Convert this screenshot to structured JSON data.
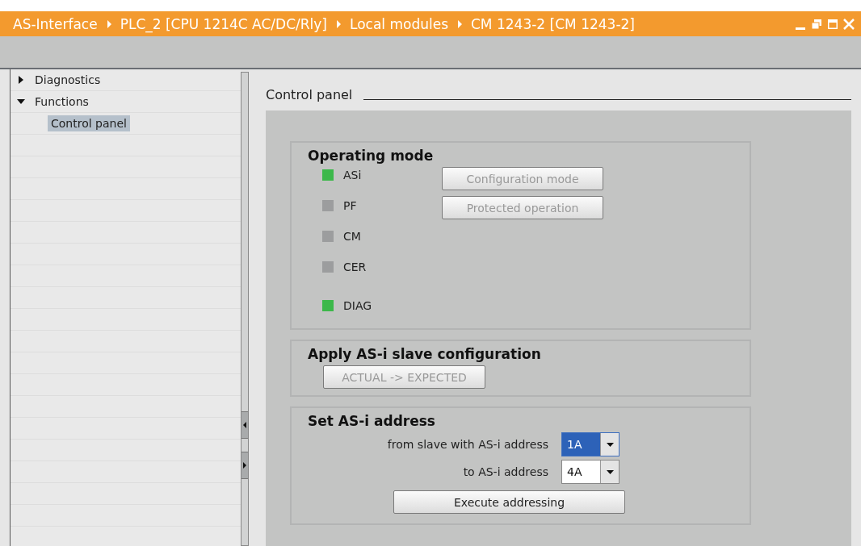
{
  "breadcrumb": [
    "AS-Interface",
    "PLC_2 [CPU 1214C AC/DC/Rly]",
    "Local modules",
    "CM 1243-2 [CM 1243-2]"
  ],
  "tree": [
    {
      "label": "Diagnostics",
      "expanded": false,
      "selected": false
    },
    {
      "label": "Functions",
      "expanded": true,
      "selected": false,
      "children": [
        {
          "label": "Control panel",
          "selected": true
        }
      ]
    }
  ],
  "section_title": "Control panel",
  "operating_mode": {
    "title": "Operating mode",
    "indicators": [
      {
        "name": "ASi",
        "color": "#3cb84a"
      },
      {
        "name": "PF",
        "color": "#9c9d9e"
      },
      {
        "name": "CM",
        "color": "#9c9d9e"
      },
      {
        "name": "CER",
        "color": "#9c9d9e"
      },
      {
        "name": "DIAG",
        "color": "#3cb84a"
      }
    ],
    "buttons": [
      {
        "label": "Configuration mode",
        "disabled": true
      },
      {
        "label": "Protected operation",
        "disabled": true
      }
    ]
  },
  "apply_config": {
    "title": "Apply AS-i slave configuration",
    "button": {
      "label": "ACTUAL -> EXPECTED",
      "disabled": true
    }
  },
  "set_address": {
    "title": "Set AS-i address",
    "fields": [
      {
        "label": "from slave with AS-i address",
        "value": "1A",
        "focused": true
      },
      {
        "label": "to AS-i address",
        "value": "4A",
        "focused": false
      }
    ],
    "button": {
      "label": "Execute addressing",
      "disabled": false
    }
  }
}
